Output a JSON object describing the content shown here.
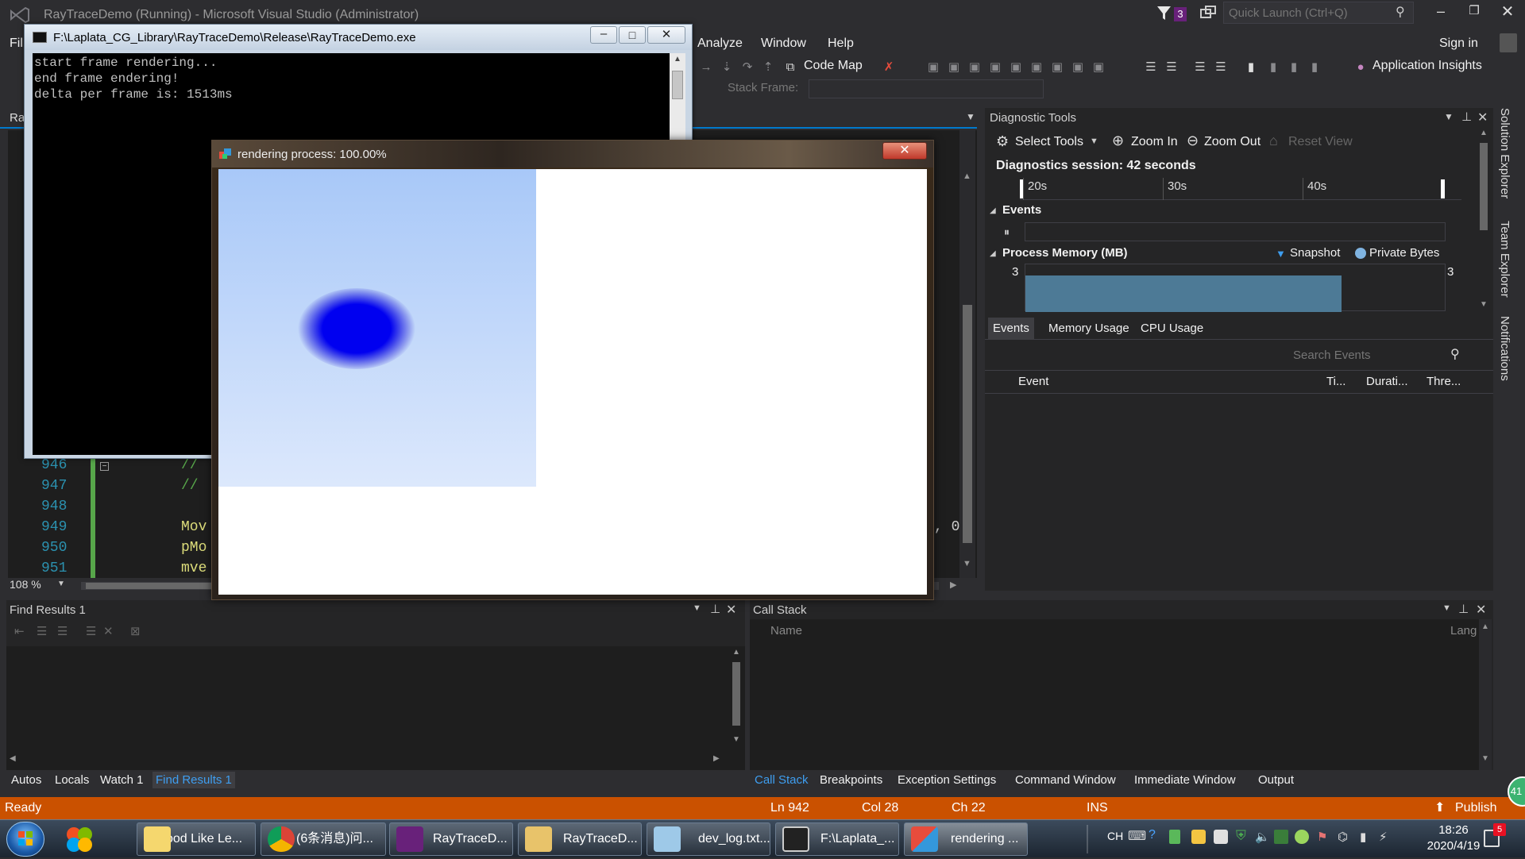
{
  "window": {
    "title": "RayTraceDemo (Running) - Microsoft Visual Studio (Administrator)",
    "notif_count": "3",
    "quick_launch_placeholder": "Quick Launch (Ctrl+Q)",
    "sign_in": "Sign in"
  },
  "menu": {
    "file": "Fil",
    "analyze": "Analyze",
    "window": "Window",
    "help": "Help"
  },
  "toolbar": {
    "code_map": "Code Map",
    "app_insights": "Application Insights",
    "stack_frame_label": "Stack Frame:"
  },
  "console": {
    "title": "F:\\Laplata_CG_Library\\RayTraceDemo\\Release\\RayTraceDemo.exe",
    "lines": [
      "start frame rendering...",
      "end frame endering!",
      "delta per frame is: 1513ms"
    ]
  },
  "render_window": {
    "title": "rendering process: 100.00%"
  },
  "editor": {
    "tab_fragment": "Ra",
    "zoom": "108 %",
    "lines": [
      {
        "num": "946",
        "code": "//"
      },
      {
        "num": "947",
        "code": "//"
      },
      {
        "num": "948",
        "code": ""
      },
      {
        "num": "949",
        "code": "Mov"
      },
      {
        "num": "950",
        "code": "pMo"
      },
      {
        "num": "951",
        "code": "mve"
      }
    ],
    "right_fragment": ", 0"
  },
  "diagnostic": {
    "title": "Diagnostic Tools",
    "select_tools": "Select Tools",
    "zoom_in": "Zoom In",
    "zoom_out": "Zoom Out",
    "reset_view": "Reset View",
    "session": "Diagnostics session: 42 seconds",
    "ticks": [
      "20s",
      "30s",
      "40s"
    ],
    "events_label": "Events",
    "memory_label": "Process Memory (MB)",
    "snapshot": "Snapshot",
    "private_bytes": "Private Bytes",
    "mem_left": "3",
    "mem_right": "3",
    "tabs": [
      "Events",
      "Memory Usage",
      "CPU Usage"
    ],
    "search_placeholder": "Search Events",
    "columns": [
      "Event",
      "Ti...",
      "Durati...",
      "Thre..."
    ]
  },
  "side_tabs": [
    "Solution Explorer",
    "Team Explorer",
    "Notifications"
  ],
  "find_results": {
    "title": "Find Results 1"
  },
  "call_stack": {
    "title": "Call Stack",
    "col_name": "Name",
    "col_lang": "Lang"
  },
  "bottom_tabs_left": [
    "Autos",
    "Locals",
    "Watch 1",
    "Find Results 1"
  ],
  "bottom_tabs_right": [
    "Call Stack",
    "Breakpoints",
    "Exception Settings",
    "Command Window",
    "Immediate Window",
    "Output"
  ],
  "status": {
    "ready": "Ready",
    "ln": "Ln 942",
    "col": "Col 28",
    "ch": "Ch 22",
    "ins": "INS",
    "publish": "Publish",
    "badge": "41"
  },
  "taskbar": {
    "items": [
      "ood Like Le...",
      "(6条消息)问...",
      "RayTraceD...",
      "RayTraceD...",
      "dev_log.txt...",
      "F:\\Laplata_...",
      "rendering ..."
    ],
    "ime": "CH",
    "time": "18:26",
    "date": "2020/4/19",
    "notif": "5"
  },
  "colors": {
    "vs_bg": "#2d2d30",
    "editor_bg": "#1e1e1e",
    "status_orange": "#ca5100",
    "accent_blue": "#3e9ef0",
    "sphere_blue": "#0000f0",
    "sky_top": "#a8c8f8",
    "sky_bottom": "#dce8fc",
    "memory_fill": "#4d7a96"
  }
}
